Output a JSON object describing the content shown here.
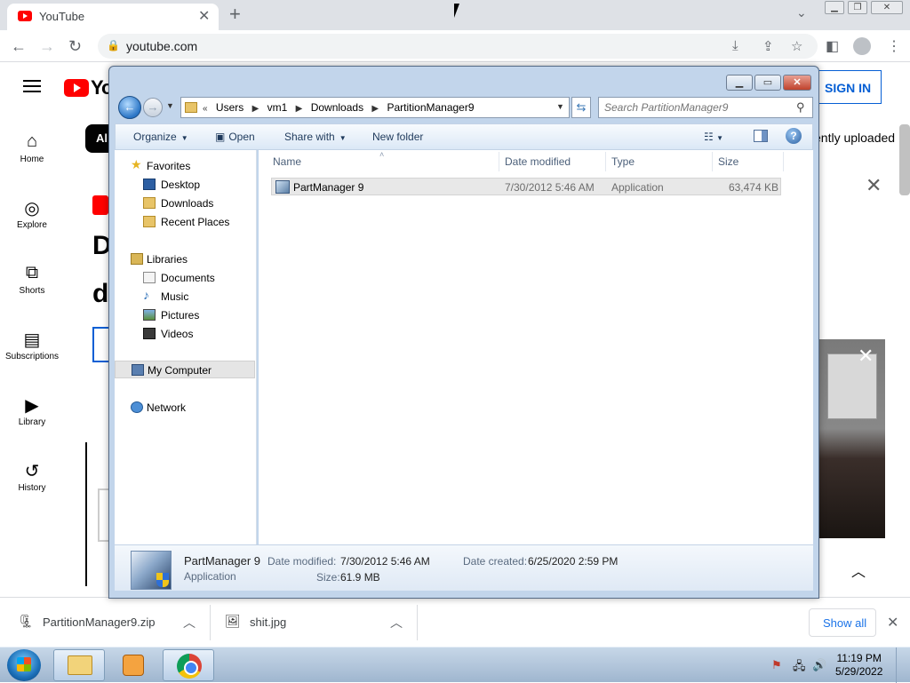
{
  "browser": {
    "tab_title": "YouTube",
    "new_tab": "+",
    "url": "youtube.com"
  },
  "youtube": {
    "logo_text": "Yo",
    "chip": "Al",
    "recent_text": "ently uploaded",
    "sign_in": "SIGN IN",
    "headline_1": "D",
    "headline_2": "d",
    "sidebar": [
      {
        "label": "Home",
        "icon": "home-icon",
        "glyph": "⌂"
      },
      {
        "label": "Explore",
        "icon": "compass-icon",
        "glyph": "◎"
      },
      {
        "label": "Shorts",
        "icon": "shorts-icon",
        "glyph": "⧉"
      },
      {
        "label": "Subscriptions",
        "icon": "subscriptions-icon",
        "glyph": "▤"
      },
      {
        "label": "Library",
        "icon": "library-icon",
        "glyph": "▶"
      },
      {
        "label": "History",
        "icon": "history-icon",
        "glyph": "↺"
      }
    ]
  },
  "explorer": {
    "address": [
      "Users",
      "vm1",
      "Downloads",
      "PartitionManager9"
    ],
    "search_placeholder": "Search PartitionManager9",
    "commands": {
      "organize": "Organize",
      "open": "Open",
      "share_with": "Share with",
      "new_folder": "New folder"
    },
    "nav": {
      "favorites": "Favorites",
      "desktop": "Desktop",
      "downloads": "Downloads",
      "recent_places": "Recent Places",
      "libraries": "Libraries",
      "documents": "Documents",
      "music": "Music",
      "pictures": "Pictures",
      "videos": "Videos",
      "my_computer": "My Computer",
      "network": "Network"
    },
    "columns": {
      "name": "Name",
      "date_modified": "Date modified",
      "type": "Type",
      "size": "Size"
    },
    "files": [
      {
        "name": "PartManager 9",
        "date_modified": "7/30/2012 5:46 AM",
        "type": "Application",
        "size": "63,474 KB"
      }
    ],
    "details": {
      "name": "PartManager 9",
      "type": "Application",
      "date_modified_label": "Date modified:",
      "date_modified": "7/30/2012 5:46 AM",
      "date_created_label": "Date created:",
      "date_created": "6/25/2020 2:59 PM",
      "size_label": "Size:",
      "size": "61.9 MB"
    }
  },
  "downloads": [
    {
      "name": "PartitionManager9.zip"
    },
    {
      "name": "shit.jpg"
    }
  ],
  "show_all": "Show all",
  "taskbar": {
    "time": "11:19 PM",
    "date": "5/29/2022"
  }
}
